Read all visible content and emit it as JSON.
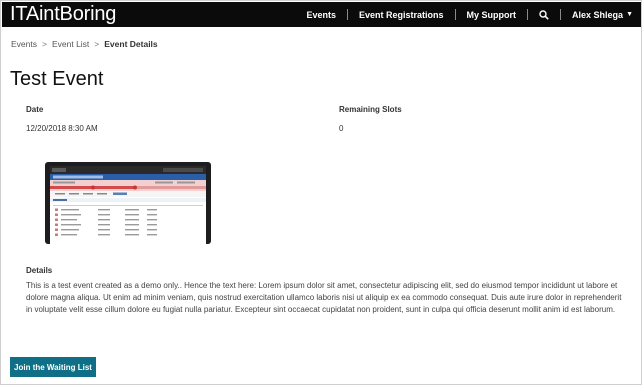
{
  "header": {
    "brand": "ITAintBoring",
    "nav": {
      "events": "Events",
      "event_registrations": "Event Registrations",
      "my_support": "My Support",
      "user": "Alex Shlega"
    }
  },
  "breadcrumb": [
    "Events",
    "Event List",
    "Event Details"
  ],
  "page": {
    "title": "Test Event",
    "date_label": "Date",
    "date_value": "12/20/2018 8:30 AM",
    "slots_label": "Remaining Slots",
    "slots_value": "0",
    "details_label": "Details",
    "details_text": "This is a test event created as a demo only.. Hence the text here: Lorem ipsum dolor sit amet, consectetur adipiscing elit, sed do eiusmod tempor incididunt ut labore et dolore magna aliqua. Ut enim ad minim veniam, quis nostrud exercitation ullamco laboris nisi ut aliquip ex ea commodo consequat. Duis aute irure dolor in reprehenderit in voluptate velit esse cillum dolore eu fugiat nulla pariatur. Excepteur sint occaecat cupidatat non proident, sunt in culpa qui officia deserunt mollit anim id est laborum.",
    "join_button": "Join the Waiting List"
  },
  "colors": {
    "topbar": "#0b0b0b",
    "button": "#0f6f86"
  }
}
